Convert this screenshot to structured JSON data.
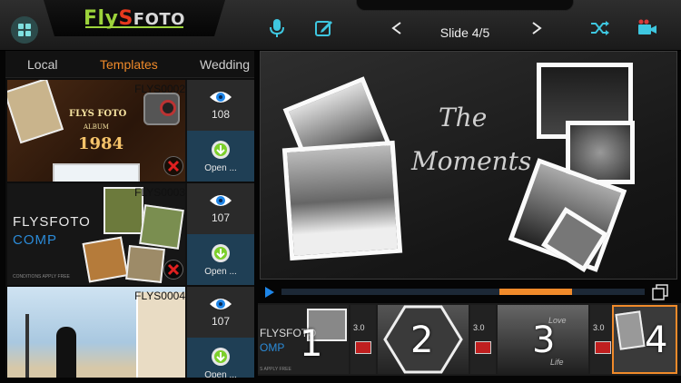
{
  "app": {
    "logo_part1": "Fly",
    "logo_part2": "S",
    "logo_part3": "FOTO"
  },
  "toolbar": {
    "slide_label": "Slide 4/5",
    "icons": [
      "grid-icon",
      "microphone-icon",
      "edit-icon",
      "previous-icon",
      "next-icon",
      "shuffle-icon",
      "video-camera-icon"
    ]
  },
  "tabs": [
    {
      "label": "Local",
      "active": false
    },
    {
      "label": "Templates",
      "active": true
    },
    {
      "label": "Wedding",
      "active": false
    }
  ],
  "templates": [
    {
      "code": "FLYS0002",
      "views": "108",
      "open_label": "Open ...",
      "title_line1": "FLYS FOTO",
      "title_line2": "ALBUM",
      "title_line3": "1984"
    },
    {
      "code": "FLYS0003",
      "views": "107",
      "open_label": "Open ...",
      "title_line1": "FLYSFOTO",
      "title_line2": "COMP",
      "footer": "CONDITIONS APPLY FREE"
    },
    {
      "code": "FLYS0004",
      "views": "107",
      "open_label": "Open ..."
    }
  ],
  "preview": {
    "line1": "The",
    "line2": "Moments"
  },
  "timeline": {
    "progress_start_fraction": 0.6,
    "progress_end_fraction": 0.8
  },
  "filmstrip": [
    {
      "number": "1",
      "text1": "FLYSFOTO",
      "text2": "OMP",
      "text3": "S APPLY FREE",
      "duration": "3.0"
    },
    {
      "number": "2",
      "duration": "3.0"
    },
    {
      "number": "3",
      "text1": "Love",
      "text2": "Life",
      "duration": "3.0"
    },
    {
      "number": "4",
      "selected": true
    }
  ],
  "colors": {
    "accent": "#f08a2a",
    "highlight": "#1e86e8",
    "logo_green": "#9cd33b",
    "logo_red": "#e6391e"
  }
}
